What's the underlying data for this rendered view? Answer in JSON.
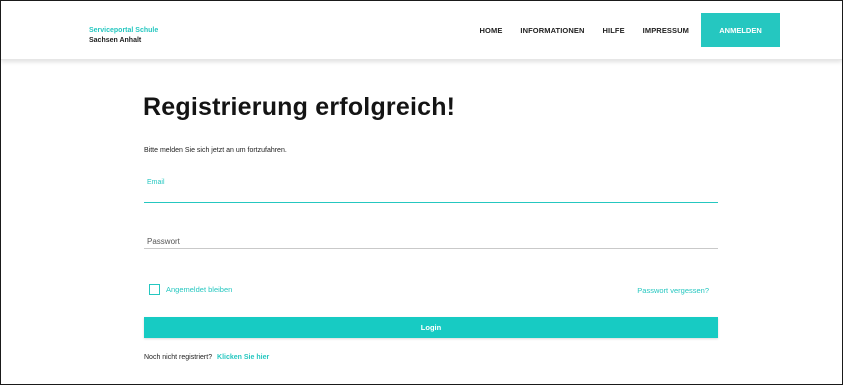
{
  "header": {
    "brand_line1": "Serviceportal Schule",
    "brand_line2": "Sachsen Anhalt",
    "nav": {
      "home": "HOME",
      "informationen": "INFORMATIONEN",
      "hilfe": "HILFE",
      "impressum": "IMPRESSUM",
      "anmelden": "ANMELDEN"
    }
  },
  "main": {
    "title": "Registrierung erfolgreich!",
    "subtitle": "Bitte melden Sie sich jetzt an um fortzufahren.",
    "email_label": "Email",
    "email_value": "",
    "password_placeholder": "Passwort",
    "remember_label": "Angemeldet bleiben",
    "remember_checked": false,
    "forgot_label": "Passwort vergessen?",
    "login_label": "Login",
    "register_prompt": "Noch nicht registriert?",
    "register_link": "Klicken Sie hier"
  },
  "colors": {
    "accent": "#25c7c0",
    "button": "#17cbc3",
    "text": "#141414"
  }
}
